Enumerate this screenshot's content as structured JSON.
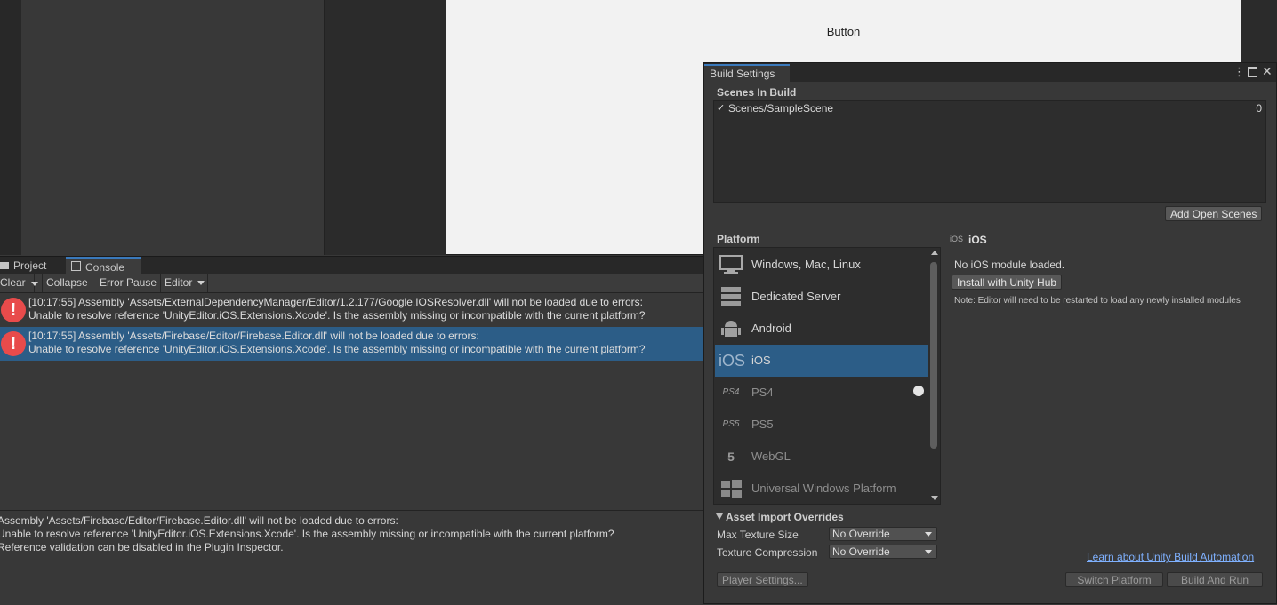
{
  "game_view": {
    "button_text": "Button"
  },
  "console": {
    "tabs": [
      "Project",
      "Console"
    ],
    "toolbar": {
      "clear": "Clear",
      "collapse": "Collapse",
      "error_pause": "Error Pause",
      "editor": "Editor"
    },
    "entries": [
      {
        "line1": "[10:17:55] Assembly 'Assets/ExternalDependencyManager/Editor/1.2.177/Google.IOSResolver.dll' will not be loaded due to errors:",
        "line2": "Unable to resolve reference 'UnityEditor.iOS.Extensions.Xcode'. Is the assembly missing or incompatible with the current platform?"
      },
      {
        "line1": "[10:17:55] Assembly 'Assets/Firebase/Editor/Firebase.Editor.dll' will not be loaded due to errors:",
        "line2": "Unable to resolve reference 'UnityEditor.iOS.Extensions.Xcode'. Is the assembly missing or incompatible with the current platform?"
      }
    ],
    "error_icon": "!",
    "detail": [
      "Assembly 'Assets/Firebase/Editor/Firebase.Editor.dll' will not be loaded due to errors:",
      "Unable to resolve reference 'UnityEditor.iOS.Extensions.Xcode'. Is the assembly missing or incompatible with the current platform?",
      "Reference validation can be disabled in the Plugin Inspector."
    ]
  },
  "build_settings": {
    "title": "Build Settings",
    "scenes_in_build": "Scenes In Build",
    "scene": {
      "checkmark": "✓",
      "name": "Scenes/SampleScene",
      "index": "0"
    },
    "add_open_scenes": "Add Open Scenes",
    "platform_label": "Platform",
    "platforms": [
      {
        "label": "Windows, Mac, Linux",
        "icon": "monitor-icon"
      },
      {
        "label": "Dedicated Server",
        "icon": "server-icon"
      },
      {
        "label": "Android",
        "icon": "android-icon"
      },
      {
        "label": "iOS",
        "icon": "ios-icon",
        "icon_text": "iOS"
      },
      {
        "label": "PS4",
        "icon": "ps4-icon",
        "icon_text": "PS4"
      },
      {
        "label": "PS5",
        "icon": "ps5-icon",
        "icon_text": "PS5"
      },
      {
        "label": "WebGL",
        "icon": "html5-icon",
        "icon_text": "5"
      },
      {
        "label": "Universal Windows Platform",
        "icon": "windows-icon"
      }
    ],
    "selected_platform": "iOS",
    "ios_header_icon": "iOS",
    "ios_header": "iOS",
    "no_module": "No iOS module loaded.",
    "install_button": "Install with Unity Hub",
    "note": "Note: Editor will need to be restarted to load any newly installed modules",
    "asset_import_overrides": "Asset Import Overrides",
    "max_texture_size_label": "Max Texture Size",
    "max_texture_size_value": "No Override",
    "texture_compression_label": "Texture Compression",
    "texture_compression_value": "No Override",
    "learn_link": "Learn about Unity Build Automation",
    "player_settings": "Player Settings...",
    "switch_platform": "Switch Platform",
    "build_and_run": "Build And Run"
  },
  "colors": {
    "selection": "#2c5d87",
    "accent": "#3a79bb",
    "link": "#7fb1ff",
    "error": "#e84b4b"
  }
}
